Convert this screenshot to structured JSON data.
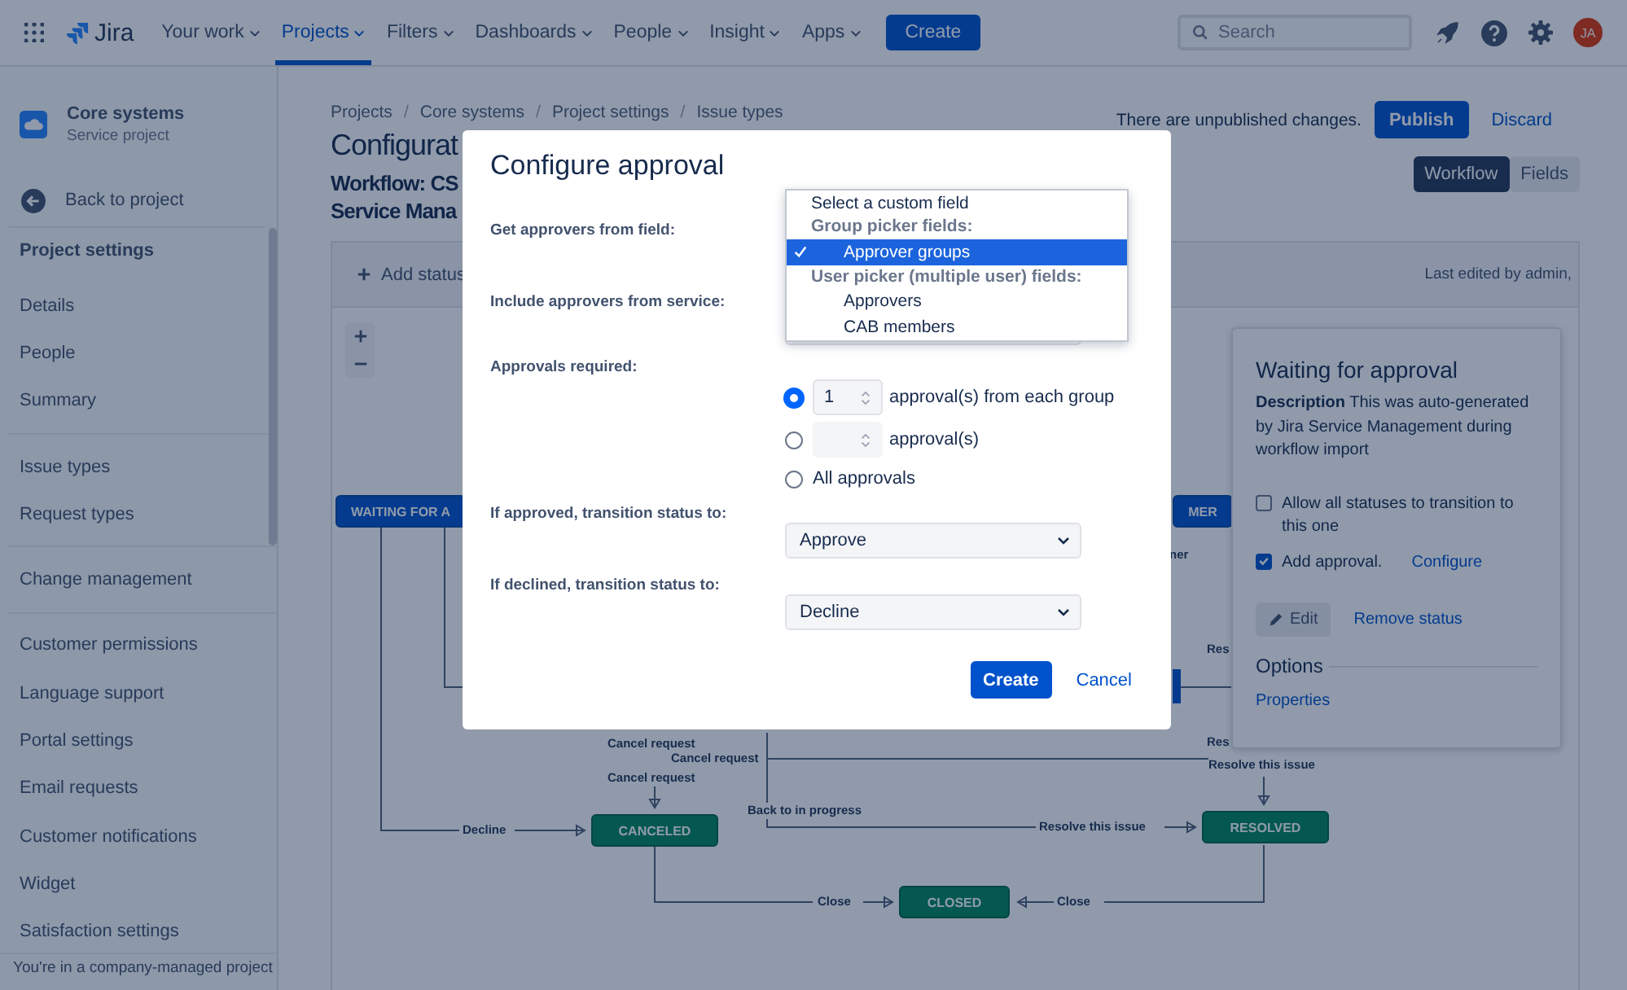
{
  "top_nav": {
    "logo": "Jira",
    "items": [
      {
        "label": "Your work",
        "selected": false
      },
      {
        "label": "Projects",
        "selected": true
      },
      {
        "label": "Filters",
        "selected": false
      },
      {
        "label": "Dashboards",
        "selected": false
      },
      {
        "label": "People",
        "selected": false
      },
      {
        "label": "Insight",
        "selected": false
      },
      {
        "label": "Apps",
        "selected": false
      }
    ],
    "create": "Create",
    "search": {
      "placeholder": "Search"
    },
    "avatar": "JA"
  },
  "sidebar": {
    "project": {
      "name": "Core systems",
      "type": "Service project"
    },
    "back": "Back to project",
    "heading": "Project settings",
    "groups": [
      [
        "Details",
        "People",
        "Summary"
      ],
      [
        "Issue types",
        "Request types"
      ],
      [
        "Change management"
      ],
      [
        "Customer permissions",
        "Language support",
        "Portal settings",
        "Email requests",
        "Customer notifications",
        "Widget",
        "Satisfaction settings"
      ]
    ],
    "footer": "You're in a company-managed project"
  },
  "page": {
    "breadcrumbs": [
      {
        "kind": "link",
        "label": "Projects"
      },
      {
        "kind": "separator",
        "label": "/"
      },
      {
        "kind": "link",
        "label": "Core systems"
      },
      {
        "kind": "separator",
        "label": "/"
      },
      {
        "kind": "link",
        "label": "Project settings"
      },
      {
        "kind": "separator",
        "label": "/"
      },
      {
        "kind": "link",
        "label": "Issue types"
      }
    ],
    "title": "Configurat",
    "subtitle_lines": [
      "Workflow: CS",
      "Service Mana"
    ],
    "notice": "There are unpublished changes.",
    "publish": "Publish",
    "discard": "Discard",
    "tabs": [
      {
        "label": "Workflow",
        "selected": true
      },
      {
        "label": "Fields",
        "selected": false
      }
    ]
  },
  "workflow": {
    "add_status": "Add status",
    "last_edited": "Last edited by admin,",
    "nodes": [
      {
        "label": "WAITING FOR A",
        "kind": "progress"
      },
      {
        "label": "MER",
        "kind": "progress"
      },
      {
        "label": "CANCELED",
        "kind": "done"
      },
      {
        "label": "RESOLVED",
        "kind": "done"
      },
      {
        "label": "CLOSED",
        "kind": "done"
      }
    ],
    "transitions": [
      "ner",
      "Res",
      "Cancel request",
      "Cancel request",
      "Res",
      "Resolve this issue",
      "Cancel request",
      "Back to in progress",
      "Decline",
      "Resolve this issue",
      "Close",
      "Close"
    ],
    "panel": {
      "title": "Waiting for approval",
      "description": "**Description** This was auto-generated by Jira Service Management during workflow import",
      "options": [
        {
          "label": "Allow all statuses to transition to this one",
          "checked": false
        },
        {
          "label": "Add approval.",
          "checked": true,
          "link": "Configure"
        }
      ],
      "edit": "Edit",
      "remove": "Remove status",
      "options_heading": "Options",
      "properties": "Properties"
    }
  },
  "modal": {
    "title": "Configure approval",
    "labels": [
      "Get approvers from field:",
      "Include approvers from service:",
      "Approvals required:",
      "If approved, transition status to:",
      "If declined, transition status to:"
    ],
    "field_options": [
      {
        "kind": "option",
        "label": "Select a custom field",
        "selected": false
      },
      {
        "kind": "group",
        "label": "Group picker fields:",
        "children": [
          {
            "label": "Approver groups",
            "selected": true
          }
        ]
      },
      {
        "kind": "group",
        "label": "User picker (multiple user) fields:",
        "children": [
          {
            "label": "Approvers",
            "selected": false
          },
          {
            "label": "CAB members",
            "selected": false
          }
        ]
      }
    ],
    "approvals": [
      {
        "kind": "count",
        "value": "1",
        "label": "approval(s) from each group",
        "selected": true
      },
      {
        "kind": "count",
        "label": "approval(s)",
        "selected": false
      },
      {
        "kind": "plain",
        "label": "All approvals",
        "selected": false
      }
    ],
    "approved_status": "Approve",
    "declined_status": "Decline",
    "create": "Create",
    "cancel": "Cancel"
  }
}
